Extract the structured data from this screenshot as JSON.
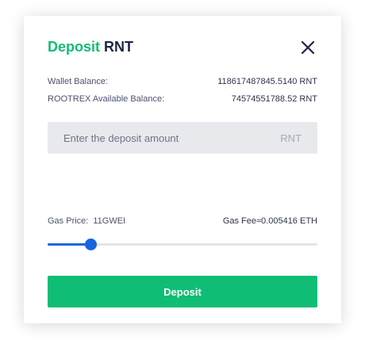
{
  "dialog": {
    "title_accent": "Deposit",
    "title_rest": "RNT",
    "close_icon": "close-icon"
  },
  "balances": {
    "wallet_label": "Wallet Balance:",
    "wallet_value": "118617487845.5140 RNT",
    "rootrex_label": "ROOTREX Available Balance:",
    "rootrex_value": "74574551788.52 RNT"
  },
  "amount": {
    "placeholder": "Enter the deposit amount",
    "value": "",
    "unit": "RNT"
  },
  "gas": {
    "price_label": "Gas Price:",
    "price_value": "11GWEI",
    "fee_text": "Gas Fee≈0.005416 ETH",
    "slider_fraction": 0.16
  },
  "actions": {
    "deposit_label": "Deposit"
  },
  "colors": {
    "accent_green": "#0fbe74",
    "slider_blue": "#1565e0",
    "title_navy": "#1d2547"
  }
}
